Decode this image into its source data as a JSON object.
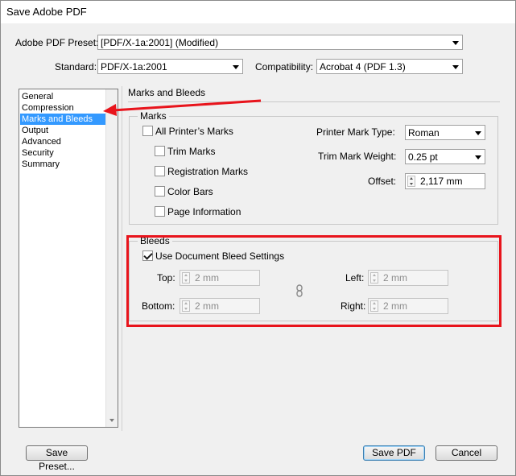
{
  "window": {
    "title": "Save Adobe PDF"
  },
  "preset": {
    "label": "Adobe PDF Preset:",
    "value": "[PDF/X-1a:2001] (Modified)"
  },
  "standard": {
    "label": "Standard:",
    "value": "PDF/X-1a:2001"
  },
  "compatibility": {
    "label": "Compatibility:",
    "value": "Acrobat 4 (PDF 1.3)"
  },
  "sidebar": {
    "items": [
      {
        "label": "General"
      },
      {
        "label": "Compression"
      },
      {
        "label": "Marks and Bleeds",
        "selected": true
      },
      {
        "label": "Output"
      },
      {
        "label": "Advanced"
      },
      {
        "label": "Security"
      },
      {
        "label": "Summary"
      }
    ]
  },
  "panel": {
    "title": "Marks and Bleeds"
  },
  "marks": {
    "legend": "Marks",
    "all_printers_marks": {
      "label": "All Printer’s Marks",
      "checked": false
    },
    "trim_marks": {
      "label": "Trim Marks",
      "checked": false
    },
    "registration_marks": {
      "label": "Registration Marks",
      "checked": false
    },
    "color_bars": {
      "label": "Color Bars",
      "checked": false
    },
    "page_information": {
      "label": "Page Information",
      "checked": false
    },
    "printer_mark_type": {
      "label": "Printer Mark Type:",
      "value": "Roman"
    },
    "trim_mark_weight": {
      "label": "Trim Mark Weight:",
      "value": "0.25 pt"
    },
    "offset": {
      "label": "Offset:",
      "value": "2,117 mm"
    }
  },
  "bleeds": {
    "legend": "Bleeds",
    "use_document": {
      "label": "Use Document Bleed Settings",
      "checked": true
    },
    "top": {
      "label": "Top:",
      "value": "2 mm"
    },
    "bottom": {
      "label": "Bottom:",
      "value": "2 mm"
    },
    "left": {
      "label": "Left:",
      "value": "2 mm"
    },
    "right": {
      "label": "Right:",
      "value": "2 mm"
    }
  },
  "buttons": {
    "save_preset": "Save Preset...",
    "save_pdf": "Save PDF",
    "cancel": "Cancel"
  },
  "annotation_colors": {
    "highlight": "#e8141c",
    "arrow": "#e8141c"
  }
}
